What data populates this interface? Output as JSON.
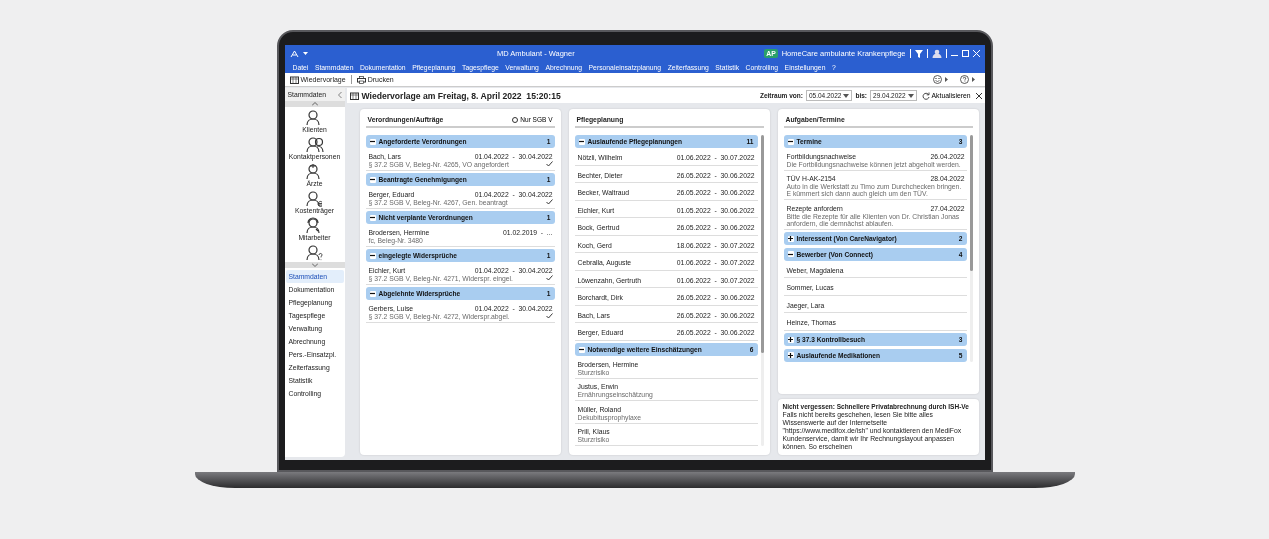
{
  "window": {
    "title": "MD Ambulant - Wagner",
    "company_badge": "AP",
    "company": "HomeCare ambulante Krankenpflege"
  },
  "menu": [
    "Datei",
    "Stammdaten",
    "Dokumentation",
    "Pflegeplanung",
    "Tagespflege",
    "Verwaltung",
    "Abrechnung",
    "Personaleinsatzplanung",
    "Zeiterfassung",
    "Statistik",
    "Controlling",
    "Einstellungen",
    "?"
  ],
  "toolbar": [
    {
      "label": "Wiedervorlage",
      "kind": "calendar"
    },
    {
      "label": "Drucken",
      "kind": "printer"
    }
  ],
  "sidebar": {
    "header": "Stammdaten",
    "icons": [
      {
        "label": "Klienten",
        "kind": "person"
      },
      {
        "label": "Kontaktpersonen",
        "kind": "group"
      },
      {
        "label": "Ärzte",
        "kind": "doctor"
      },
      {
        "label": "Kostenträger",
        "kind": "payer"
      },
      {
        "label": "Mitarbeiter",
        "kind": "staff"
      },
      {
        "kind": "unknown"
      }
    ],
    "nav": [
      {
        "label": "Stammdaten",
        "selected": true
      },
      {
        "label": "Dokumentation",
        "selected": false
      },
      {
        "label": "Pflegeplanung",
        "selected": false
      },
      {
        "label": "Tagespflege",
        "selected": false
      },
      {
        "label": "Verwaltung",
        "selected": false
      },
      {
        "label": "Abrechnung",
        "selected": false
      },
      {
        "label": "Pers.-Einsatzpl.",
        "selected": false
      },
      {
        "label": "Zeiterfassung",
        "selected": false
      },
      {
        "label": "Statistik",
        "selected": false
      },
      {
        "label": "Controlling",
        "selected": false
      }
    ]
  },
  "header": {
    "title": "Wiedervorlage am Freitag, 8. April 2022  15:20:15",
    "from_label": "Zeitraum von:",
    "from": "05.04.2022",
    "to_label": "bis:",
    "to": "29.04.2022",
    "refresh": "Aktualisieren"
  },
  "orders": {
    "title": "Verordnungen/Aufträge",
    "filter": {
      "label": "Nur SGB V",
      "checked": false
    },
    "groups": [
      {
        "title": "Angeforderte Verordnungen",
        "count": "1",
        "expanded": true,
        "items": [
          {
            "name": "Bach, Lars",
            "period": "01.04.2022  -  30.04.2022",
            "detail": "§ 37.2 SGB V, Beleg-Nr. 4265, VO angefordert",
            "done": true
          }
        ]
      },
      {
        "title": "Beantragte Genehmigungen",
        "count": "1",
        "expanded": true,
        "items": [
          {
            "name": "Berger, Eduard",
            "period": "01.04.2022  -  30.04.2022",
            "detail": "§ 37.2 SGB V, Beleg-Nr. 4267, Gen. beantragt",
            "done": true
          }
        ]
      },
      {
        "title": "Nicht verplante Verordnungen",
        "count": "1",
        "expanded": true,
        "items": [
          {
            "name": "Brodersen, Hermine",
            "period": "01.02.2019  -  ...",
            "detail": "fc, Beleg-Nr. 3480",
            "done": false
          }
        ]
      },
      {
        "title": "eingelegte Widersprüche",
        "count": "1",
        "expanded": true,
        "items": [
          {
            "name": "Eichler, Kurt",
            "period": "01.04.2022  -  30.04.2022",
            "detail": "§ 37.2 SGB V, Beleg-Nr. 4271, Widerspr. eingel.",
            "done": true
          }
        ]
      },
      {
        "title": "Abgelehnte Widersprüche",
        "count": "1",
        "expanded": true,
        "items": [
          {
            "name": "Gerbers, Luise",
            "period": "01.04.2022  -  30.04.2022",
            "detail": "§ 37.2 SGB V, Beleg-Nr. 4272, Widerspr.abgel.",
            "done": true
          }
        ]
      }
    ]
  },
  "care_planning": {
    "title": "Pflegeplanung",
    "groups": [
      {
        "title": "Auslaufende Pflegeplanungen",
        "count": "11",
        "expanded": true,
        "items": [
          {
            "name": "Nötzli, Wilhelm",
            "period": "01.06.2022  -  30.07.2022"
          },
          {
            "name": "Bechter, Dieter",
            "period": "26.05.2022  -  30.06.2022"
          },
          {
            "name": "Becker, Waltraud",
            "period": "26.05.2022  -  30.06.2022"
          },
          {
            "name": "Eichler, Kurt",
            "period": "01.05.2022  -  30.06.2022"
          },
          {
            "name": "Bock, Gertrud",
            "period": "26.05.2022  -  30.06.2022"
          },
          {
            "name": "Koch, Gerd",
            "period": "18.06.2022  -  30.07.2022"
          },
          {
            "name": "Cebralla, Auguste",
            "period": "01.06.2022  -  30.07.2022"
          },
          {
            "name": "Löwenzahn, Gertruth",
            "period": "01.06.2022  -  30.07.2022"
          },
          {
            "name": "Borchardt, Dirk",
            "period": "26.05.2022  -  30.06.2022"
          },
          {
            "name": "Bach, Lars",
            "period": "26.05.2022  -  30.06.2022"
          },
          {
            "name": "Berger, Eduard",
            "period": "26.05.2022  -  30.06.2022"
          }
        ]
      },
      {
        "title": "Notwendige weitere Einschätzungen",
        "count": "6",
        "expanded": true,
        "items": [
          {
            "name": "Brodersen, Hermine",
            "detail": "Sturzrisiko"
          },
          {
            "name": "Justus, Erwin",
            "detail": "Ernährungseinschätzung"
          },
          {
            "name": "Müller, Roland",
            "detail": "Dekubitusprophylaxe"
          },
          {
            "name": "Prill, Klaus",
            "detail": "Sturzrisiko"
          }
        ]
      }
    ]
  },
  "tasks": {
    "title": "Aufgaben/Termine",
    "groups": [
      {
        "title": "Termine",
        "count": "3",
        "expanded": true,
        "items": [
          {
            "name": "Fortbildungsnachweise",
            "period": "26.04.2022",
            "detail": "Die Fortbildungsnachweise können jetzt abgeholt werden."
          },
          {
            "name": "TÜV H-AK-2154",
            "period": "28.04.2022",
            "detail": "Auto in die Werkstatt zu Timo zum Durchchecken bringen. E kümmert sich dann auch gleich um den TÜV."
          },
          {
            "name": "Rezepte anfordern",
            "period": "27.04.2022",
            "detail": "Bitte die Rezepte für alle Klienten von Dr. Christian Jonas anfordern, die demnächst  ablaufen."
          }
        ]
      },
      {
        "title": "Interessent (Von CareNavigator)",
        "count": "2",
        "expanded": false
      },
      {
        "title": "Bewerber (Von Connect)",
        "count": "4",
        "expanded": true,
        "items": [
          {
            "name": "Weber, Magdalena"
          },
          {
            "name": "Sommer, Lucas"
          },
          {
            "name": "Jaeger, Lara"
          },
          {
            "name": "Heinze, Thomas"
          }
        ]
      },
      {
        "title": "§ 37.3 Kontrollbesuch",
        "count": "3",
        "expanded": false
      },
      {
        "title": "Auslaufende Medikationen",
        "count": "5",
        "expanded": false
      }
    ]
  },
  "note": {
    "title": "Nicht vergessen: Schnellere Privatabrechnung durch ISH-Ve",
    "text": "Falls nicht bereits geschehen, lesen Sie bitte alles Wissenswerte auf der Internetseite \"https://www.medifox.de/ish\" und kontaktieren den MediFox Kundenservice, damit wir Ihr Rechnungslayout anpassen können. So erscheinen"
  }
}
